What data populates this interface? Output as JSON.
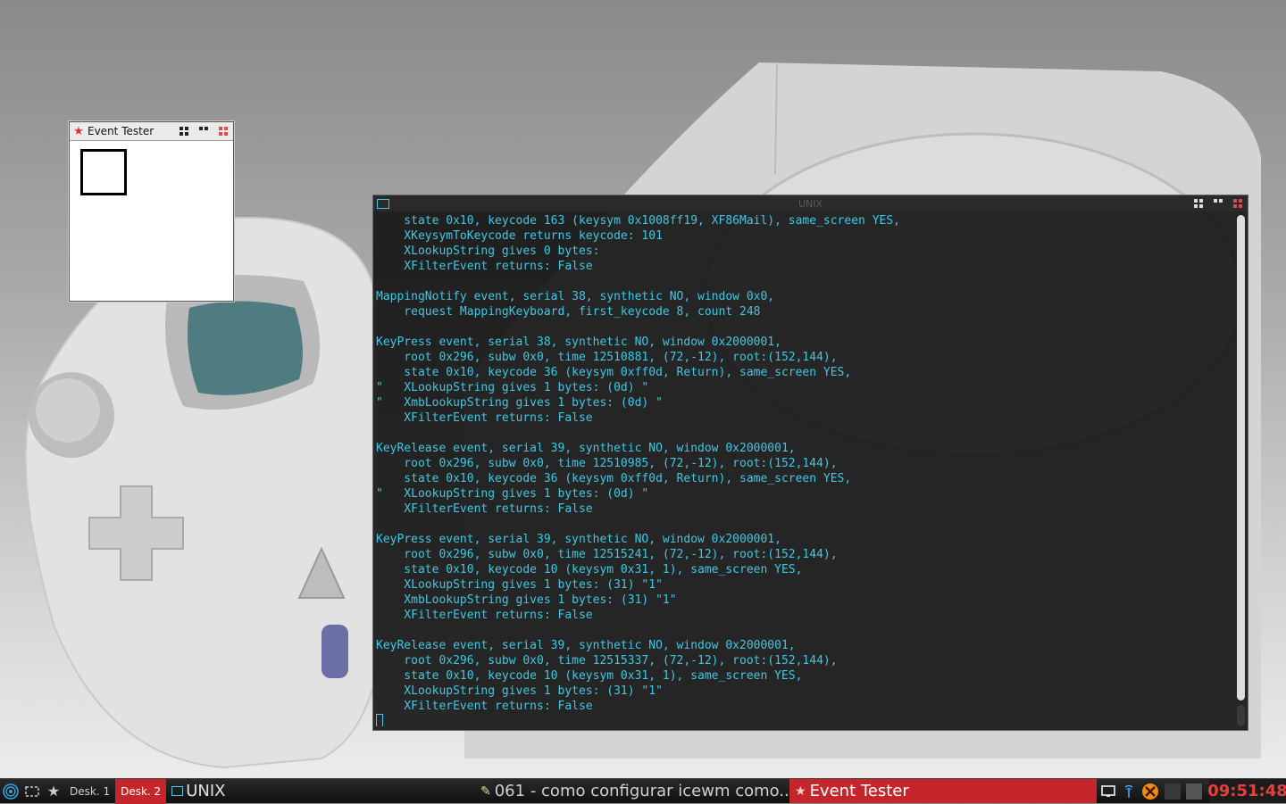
{
  "event_tester": {
    "title": "Event Tester"
  },
  "terminal": {
    "title": "UNIX",
    "lines": [
      "    state 0x10, keycode 163 (keysym 0x1008ff19, XF86Mail), same_screen YES,",
      "    XKeysymToKeycode returns keycode: 101",
      "    XLookupString gives 0 bytes:",
      "    XFilterEvent returns: False",
      "",
      "MappingNotify event, serial 38, synthetic NO, window 0x0,",
      "    request MappingKeyboard, first_keycode 8, count 248",
      "",
      "KeyPress event, serial 38, synthetic NO, window 0x2000001,",
      "    root 0x296, subw 0x0, time 12510881, (72,-12), root:(152,144),",
      "    state 0x10, keycode 36 (keysym 0xff0d, Return), same_screen YES,",
      "\"   XLookupString gives 1 bytes: (0d) \"",
      "\"   XmbLookupString gives 1 bytes: (0d) \"",
      "    XFilterEvent returns: False",
      "",
      "KeyRelease event, serial 39, synthetic NO, window 0x2000001,",
      "    root 0x296, subw 0x0, time 12510985, (72,-12), root:(152,144),",
      "    state 0x10, keycode 36 (keysym 0xff0d, Return), same_screen YES,",
      "\"   XLookupString gives 1 bytes: (0d) \"",
      "    XFilterEvent returns: False",
      "",
      "KeyPress event, serial 39, synthetic NO, window 0x2000001,",
      "    root 0x296, subw 0x0, time 12515241, (72,-12), root:(152,144),",
      "    state 0x10, keycode 10 (keysym 0x31, 1), same_screen YES,",
      "    XLookupString gives 1 bytes: (31) \"1\"",
      "    XmbLookupString gives 1 bytes: (31) \"1\"",
      "    XFilterEvent returns: False",
      "",
      "KeyRelease event, serial 39, synthetic NO, window 0x2000001,",
      "    root 0x296, subw 0x0, time 12515337, (72,-12), root:(152,144),",
      "    state 0x10, keycode 10 (keysym 0x31, 1), same_screen YES,",
      "    XLookupString gives 1 bytes: (31) \"1\"",
      "    XFilterEvent returns: False"
    ]
  },
  "taskbar": {
    "desktops": [
      "Desk. 1",
      "Desk. 2"
    ],
    "active_desktop": "Desk. 2",
    "unix_label": "UNIX",
    "task1_label": "061 - como configurar icewm como...",
    "task2_label": "Event Tester",
    "clock": "09:51:48"
  },
  "colors": {
    "accent_red": "#c4262b",
    "terminal_text": "#3fc8e4",
    "clock_text": "#e7403b"
  },
  "icons": [
    "menu-swirl-icon",
    "show-desktop-icon",
    "star-icon",
    "terminal-icon",
    "notepad-icon",
    "monitor-icon",
    "network-icon",
    "close-x-icon",
    "cpu-meter-icon"
  ]
}
